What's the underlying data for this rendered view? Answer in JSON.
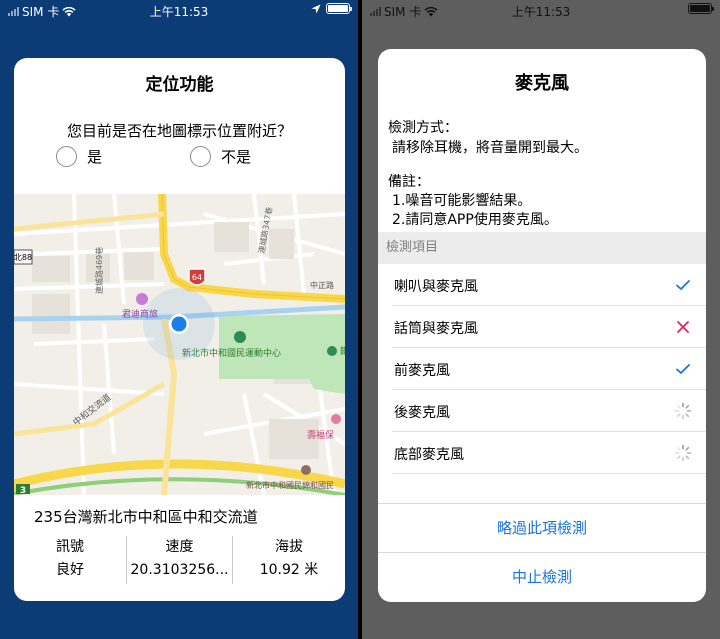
{
  "status_left": {
    "carrier": "SIM 卡",
    "time": "上午11:53"
  },
  "status_right": {
    "carrier": "SIM 卡",
    "time": "上午11:53"
  },
  "location_dialog": {
    "title": "定位功能",
    "question": "您目前是否在地圖標示位置附近？",
    "option_yes": "是",
    "option_no": "不是",
    "map": {
      "labels": {
        "road_469": "連城路469巷",
        "road_347": "連城路347巷",
        "zhongzheng": "中正路",
        "hotel": "君迪商旅",
        "sports_center": "新北市中和國民運動中心",
        "zhonghe_jiaoliu": "中和交流道",
        "zhonghe_school": "新北市中和國民錦和國民",
        "route_88": "北88",
        "route_64": "64",
        "route_3": "3",
        "shou": "壽福保",
        "tie": "鐵"
      }
    },
    "address": "235台灣新北市中和區中和交流道",
    "stats": [
      {
        "label": "訊號",
        "value": "良好"
      },
      {
        "label": "速度",
        "value": "20.3103256..."
      },
      {
        "label": "海拔",
        "value": "10.92 米"
      }
    ]
  },
  "mic_dialog": {
    "title": "麥克風",
    "method_label": "檢測方式：",
    "method_text": "請移除耳機，將音量開到最大。",
    "note_label": "備註：",
    "note_1": "1.噪音可能影響結果。",
    "note_2": "2.請同意APP使用麥克風。",
    "section_header": "檢測項目",
    "items": [
      {
        "label": "喇叭與麥克風",
        "status": "check-icon"
      },
      {
        "label": "話筒與麥克風",
        "status": "cross-icon"
      },
      {
        "label": "前麥克風",
        "status": "check-icon"
      },
      {
        "label": "後麥克風",
        "status": "spinner-icon"
      },
      {
        "label": "底部麥克風",
        "status": "spinner-icon"
      }
    ],
    "skip_button": "略過此項檢測",
    "stop_button": "中止檢測"
  },
  "colors": {
    "accent": "#1a73d9",
    "error": "#e0245e",
    "left_bg": "#0c3c76",
    "right_bg": "#5e5e5e"
  }
}
